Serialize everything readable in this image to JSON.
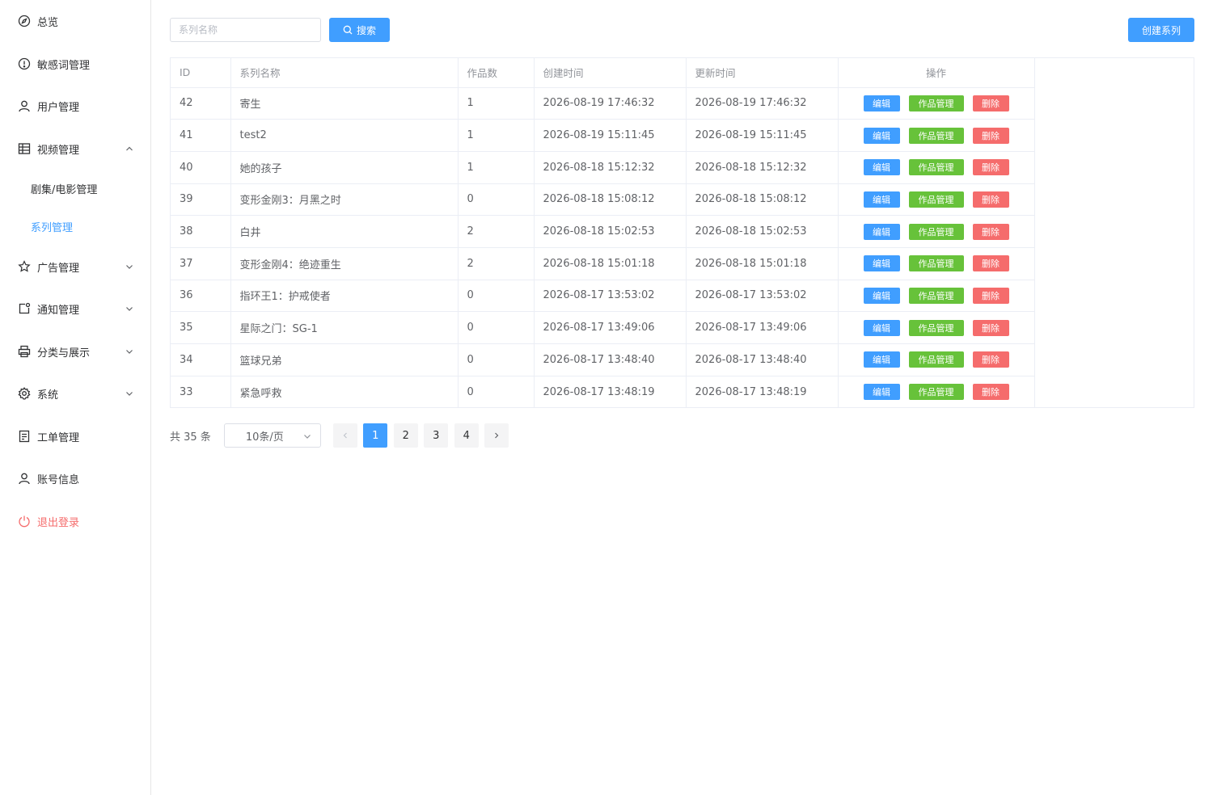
{
  "sidebar": {
    "items": [
      {
        "label": "总览",
        "icon": "compass-icon"
      },
      {
        "label": "敏感词管理",
        "icon": "warning-circle-icon"
      },
      {
        "label": "用户管理",
        "icon": "user-icon"
      },
      {
        "label": "视频管理",
        "icon": "grid-icon",
        "expanded": true
      },
      {
        "label": "剧集/电影管理"
      },
      {
        "label": "系列管理",
        "active": true
      },
      {
        "label": "广告管理",
        "icon": "star-icon"
      },
      {
        "label": "通知管理",
        "icon": "notification-icon"
      },
      {
        "label": "分类与展示",
        "icon": "printer-icon"
      },
      {
        "label": "系统",
        "icon": "gear-icon"
      },
      {
        "label": "工单管理",
        "icon": "document-icon"
      },
      {
        "label": "账号信息",
        "icon": "user-icon"
      },
      {
        "label": "退出登录",
        "icon": "power-icon"
      }
    ]
  },
  "toolbar": {
    "search_placeholder": "系列名称",
    "search_label": "搜索",
    "create_label": "创建系列"
  },
  "table": {
    "columns": [
      "ID",
      "系列名称",
      "作品数",
      "创建时间",
      "更新时间",
      "操作"
    ],
    "actions": {
      "edit": "编辑",
      "works": "作品管理",
      "delete": "删除"
    },
    "rows": [
      [
        "42",
        "寄生",
        "1",
        "2026-08-19 17:46:32",
        "2026-08-19 17:46:32"
      ],
      [
        "41",
        "test2",
        "1",
        "2026-08-19 15:11:45",
        "2026-08-19 15:11:45"
      ],
      [
        "40",
        "她的孩子",
        "1",
        "2026-08-18 15:12:32",
        "2026-08-18 15:12:32"
      ],
      [
        "39",
        "变形金刚3：月黑之时",
        "0",
        "2026-08-18 15:08:12",
        "2026-08-18 15:08:12"
      ],
      [
        "38",
        "白井",
        "2",
        "2026-08-18 15:02:53",
        "2026-08-18 15:02:53"
      ],
      [
        "37",
        "变形金刚4：绝迹重生",
        "2",
        "2026-08-18 15:01:18",
        "2026-08-18 15:01:18"
      ],
      [
        "36",
        "指环王1：护戒使者",
        "0",
        "2026-08-17 13:53:02",
        "2026-08-17 13:53:02"
      ],
      [
        "35",
        "星际之门：SG-1",
        "0",
        "2026-08-17 13:49:06",
        "2026-08-17 13:49:06"
      ],
      [
        "34",
        "篮球兄弟",
        "0",
        "2026-08-17 13:48:40",
        "2026-08-17 13:48:40"
      ],
      [
        "33",
        "紧急呼救",
        "0",
        "2026-08-17 13:48:19",
        "2026-08-17 13:48:19"
      ]
    ]
  },
  "pagination": {
    "total_label": "共 35 条",
    "page_size": "10条/页",
    "pages": [
      "1",
      "2",
      "3",
      "4"
    ],
    "current": "1"
  },
  "colors": {
    "primary": "#409eff",
    "success": "#67c23a",
    "danger": "#f56c6c"
  }
}
